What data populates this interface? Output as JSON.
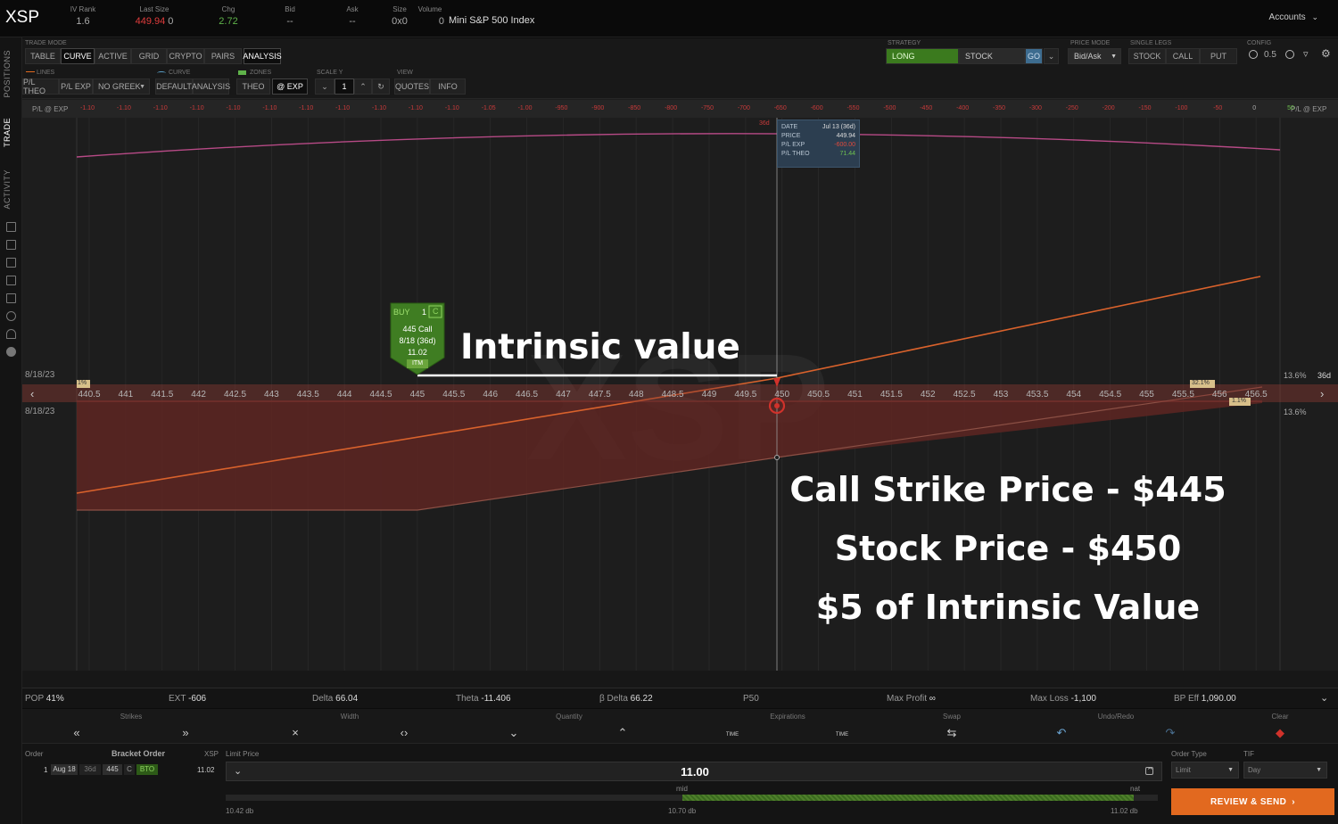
{
  "header": {
    "symbol": "XSP",
    "quote": [
      {
        "label": "IV Rank",
        "value": "1.6"
      },
      {
        "label": "Last Size",
        "value": "449.94",
        "extra": "0"
      },
      {
        "label": "Chg",
        "value": "2.72"
      },
      {
        "label": "Bid",
        "value": "--"
      },
      {
        "label": "Ask",
        "value": "--"
      },
      {
        "label": "Size",
        "value": "0x0"
      }
    ],
    "volume_label": "Volume",
    "volume_value": "0",
    "description": "Mini S&P 500 Index",
    "accounts_label": "Accounts"
  },
  "side_tabs": {
    "positions": "POSITIONS",
    "trade": "TRADE",
    "activity": "ACTIVITY"
  },
  "trade_mode": {
    "label": "TRADE MODE",
    "tabs": [
      "TABLE",
      "CURVE",
      "ACTIVE",
      "GRID",
      "CRYPTO",
      "PAIRS",
      "ANALYSIS"
    ]
  },
  "strategy": {
    "label": "STRATEGY",
    "long": "LONG",
    "stock": "STOCK",
    "go": "GO"
  },
  "price_mode": {
    "label": "PRICE MODE",
    "value": "Bid/Ask"
  },
  "single_legs": {
    "label": "SINGLE LEGS",
    "items": [
      "STOCK",
      "CALL",
      "PUT"
    ]
  },
  "config": {
    "label": "CONFIG",
    "value": "0.5"
  },
  "toolbar2": {
    "lines_label": "LINES",
    "lines": [
      "P/L THEO",
      "P/L EXP",
      "NO GREEK"
    ],
    "curve_label": "CURVE",
    "curve": [
      "DEFAULT",
      "ANALYSIS"
    ],
    "zones_label": "ZONES",
    "zones": [
      "THEO",
      "@ EXP"
    ],
    "scale_label": "SCALE Y",
    "scale_value": "1",
    "view_label": "VIEW",
    "view": [
      "QUOTES",
      "INFO"
    ]
  },
  "pl_axis": {
    "left_label": "P/L @ EXP",
    "right_label": "P/L @ EXP",
    "ticks": [
      "-1.10",
      "-1.10",
      "-1.10",
      "-1.10",
      "-1.10",
      "-1.10",
      "-1.10",
      "-1.10",
      "-1.10",
      "-1.10",
      "-1.10",
      "-1.05",
      "-1.00",
      "-950",
      "-900",
      "-850",
      "-800",
      "-750",
      "-700",
      "-650",
      "-600",
      "-550",
      "-500",
      "-450",
      "-400",
      "-350",
      "-300",
      "-250",
      "-200",
      "-150",
      "-100",
      "-50",
      "0",
      "50"
    ]
  },
  "strikes": [
    "440.5",
    "441",
    "441.5",
    "442",
    "442.5",
    "443",
    "443.5",
    "444",
    "444.5",
    "445",
    "445.5",
    "446",
    "446.5",
    "447",
    "447.5",
    "448",
    "448.5",
    "449",
    "449.5",
    "450",
    "450.5",
    "451",
    "451.5",
    "452",
    "452.5",
    "453",
    "453.5",
    "454",
    "454.5",
    "455",
    "455.5",
    "456",
    "456.5"
  ],
  "chart": {
    "date_top": "8/18/23",
    "date_bottom": "8/18/23",
    "days_top": "36d",
    "days_right": "36d",
    "pct_top": "13.6%",
    "pct_bottom": "13.6%",
    "badge_left": "1%",
    "badge_right": "32.1%",
    "badge_right2": "1.1%",
    "watermark": "XSP"
  },
  "tooltip": {
    "rows": [
      {
        "k": "DATE",
        "v": "Jul 13 (36d)"
      },
      {
        "k": "PRICE",
        "v": "449.94"
      },
      {
        "k": "P/L EXP",
        "v": "-600.00"
      },
      {
        "k": "P/L THEO",
        "v": "71.44"
      }
    ]
  },
  "order_tag": {
    "side": "BUY",
    "qty": "1",
    "qty_badge": "C",
    "line1": "445 Call",
    "line2": "8/18 (36d)",
    "line3": "11.02",
    "badge": "ITM"
  },
  "annotations": {
    "intrinsic_label": "Intrinsic value",
    "line1": "Call Strike Price - $445",
    "line2": "Stock Price - $450",
    "line3": "$5 of Intrinsic Value"
  },
  "stats": [
    {
      "label": "POP",
      "value": "41%"
    },
    {
      "label": "EXT",
      "value": "-606"
    },
    {
      "label": "Delta",
      "value": "66.04"
    },
    {
      "label": "Theta",
      "value": "-11.406"
    },
    {
      "label": "β Delta",
      "value": "66.22"
    },
    {
      "label": "P50",
      "value": ""
    },
    {
      "label": "Max Profit",
      "value": "∞"
    },
    {
      "label": "Max Loss",
      "value": "-1,100"
    },
    {
      "label": "BP Eff",
      "value": "1,090.00"
    }
  ],
  "controls": {
    "labels": [
      "Strikes",
      "Width",
      "Quantity",
      "Expirations",
      "Swap",
      "Undo/Redo",
      "Clear"
    ],
    "time_label": "TIME"
  },
  "order": {
    "order_label": "Order",
    "bracket_label": "Bracket Order",
    "symbol": "XSP",
    "qty": "1",
    "expiry": "Aug 18",
    "dte": "36d",
    "strike": "445",
    "type": "C",
    "action": "BTO",
    "price": "11.02",
    "limit_label": "Limit Price",
    "limit_value": "11.00",
    "mid_label": "mid",
    "nat_label": "nat",
    "low_db": "10.42 db",
    "mid_db": "10.70 db",
    "high_db": "11.02 db",
    "order_type_label": "Order Type",
    "order_type_value": "Limit",
    "tif_label": "TIF",
    "tif_value": "Day",
    "review_label": "REVIEW & SEND"
  }
}
